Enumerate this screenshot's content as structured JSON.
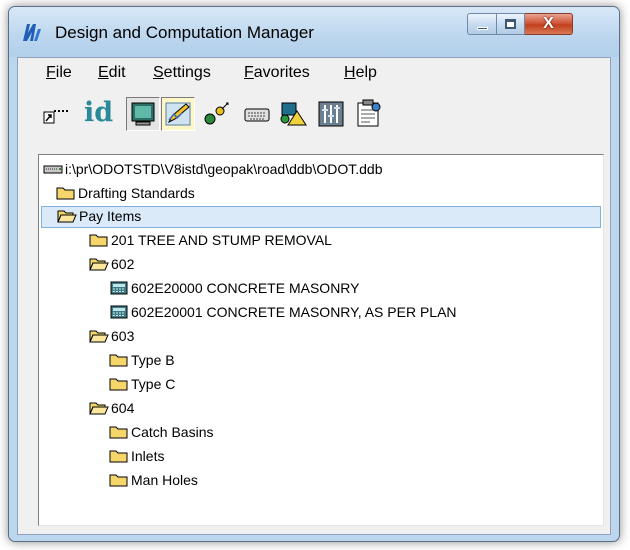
{
  "window": {
    "title": "Design and Computation Manager",
    "close_glyph": "X"
  },
  "menu": [
    {
      "label": "File",
      "underline": "F",
      "rest": "ile"
    },
    {
      "label": "Edit",
      "underline": "E",
      "rest": "dit"
    },
    {
      "label": "Settings",
      "underline": "S",
      "rest": "ettings"
    },
    {
      "label": "Favorites",
      "underline": "F",
      "rest": "avorites"
    },
    {
      "label": "Help",
      "underline": "H",
      "rest": "elp"
    }
  ],
  "toolbar": {
    "id_label": "id",
    "buttons": [
      "shortcut-line-icon",
      "id-icon",
      "monitor-icon",
      "pen-icon",
      "node-icon",
      "keyboard-icon",
      "shapes-icon",
      "columns-icon",
      "clipboard-settings-icon"
    ]
  },
  "tree": [
    {
      "label": "i:\\pr\\ODOTSTD\\V8istd\\geopak\\road\\ddb\\ODOT.ddb",
      "icon": "drive-icon",
      "level": 0
    },
    {
      "label": "Drafting Standards",
      "icon": "folder-closed-icon",
      "level": 1
    },
    {
      "label": "Pay Items",
      "icon": "folder-open-icon",
      "level": 1,
      "selected": true
    },
    {
      "label": "201 TREE AND STUMP REMOVAL",
      "icon": "folder-closed-icon",
      "level": 2
    },
    {
      "label": "602",
      "icon": "folder-open-icon",
      "level": 2
    },
    {
      "label": "602E20000 CONCRETE MASONRY",
      "icon": "calculator-icon",
      "level": 3
    },
    {
      "label": "602E20001 CONCRETE MASONRY, AS PER PLAN",
      "icon": "calculator-icon",
      "level": 3
    },
    {
      "label": "603",
      "icon": "folder-open-icon",
      "level": 2
    },
    {
      "label": "Type B",
      "icon": "folder-closed-icon",
      "level": 3
    },
    {
      "label": "Type C",
      "icon": "folder-closed-icon",
      "level": 3
    },
    {
      "label": "604",
      "icon": "folder-open-icon",
      "level": 2
    },
    {
      "label": "Catch Basins",
      "icon": "folder-closed-icon",
      "level": 3
    },
    {
      "label": "Inlets",
      "icon": "folder-closed-icon",
      "level": 3
    },
    {
      "label": "Man Holes",
      "icon": "folder-closed-icon",
      "level": 3
    }
  ],
  "colors": {
    "selection": "#dbeaf8",
    "folder": "#f6d66a",
    "close_button": "#c94b2e"
  }
}
